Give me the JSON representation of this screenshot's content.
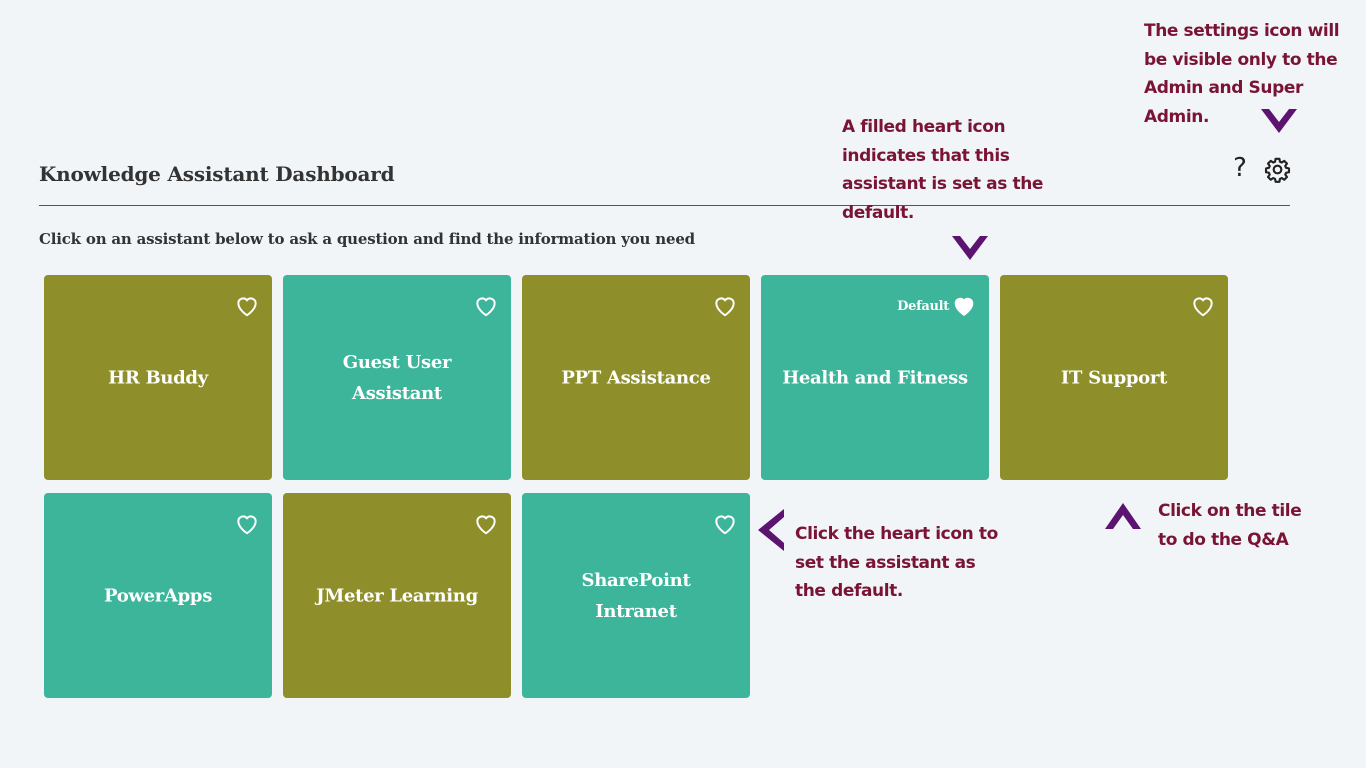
{
  "header": {
    "title": "Knowledge Assistant Dashboard",
    "subtitle": "Click on an assistant below to ask a question and find the information you need",
    "help_icon": "?",
    "icons": [
      "help-icon",
      "gear-icon"
    ]
  },
  "tiles": [
    {
      "label": "HR Buddy",
      "color": "#8e8f2b",
      "heart": "outline"
    },
    {
      "label": "Guest User Assistant",
      "color": "#3db59a",
      "heart": "outline"
    },
    {
      "label": "PPT Assistance",
      "color": "#8e8f2b",
      "heart": "outline"
    },
    {
      "label": "Health and Fitness",
      "color": "#3db59a",
      "heart": "filled",
      "default_label": "Default"
    },
    {
      "label": "IT Support",
      "color": "#8e8f2b",
      "heart": "outline"
    },
    {
      "label": "PowerApps",
      "color": "#3db59a",
      "heart": "outline"
    },
    {
      "label": "JMeter Learning",
      "color": "#8e8f2b",
      "heart": "outline"
    },
    {
      "label": "SharePoint Intranet",
      "color": "#3db59a",
      "heart": "outline"
    }
  ],
  "annotations": {
    "settings_note": "The settings icon will be visible only to the Admin and Super Admin.",
    "default_note": "A filled heart icon indicates that this assistant is set as the default.",
    "heart_note": "Click the heart icon to set the assistant as the default.",
    "tile_note": "Click on the tile to do the Q&A",
    "note_color": "#7a1434",
    "arrow_color": "#5c1470"
  }
}
